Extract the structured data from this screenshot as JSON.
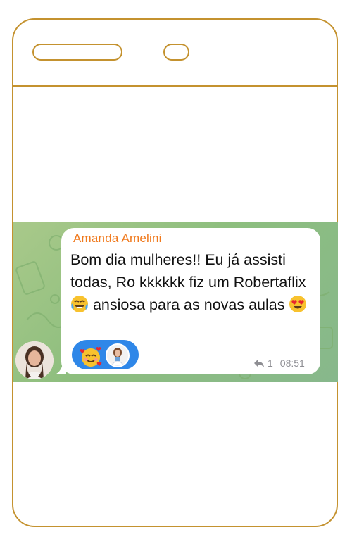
{
  "message": {
    "sender": "Amanda Amelini",
    "text_part1": "Bom dia mulheres!! Eu já assisti todas, Ro kkkkkk fiz um Robertaflix ",
    "text_part2": " ansiosa para as novas aulas ",
    "emoji_1": "face-with-tears-of-joy",
    "emoji_2": "smiling-face-with-heart-eyes",
    "reply_count": "1",
    "time": "08:51"
  },
  "reaction": {
    "emoji": "smiling-face-with-hearts"
  },
  "colors": {
    "frame": "#c4922f",
    "sender": "#f0791c",
    "reaction_bg": "#2f87e8",
    "chat_bg": "#8dbe7e"
  }
}
